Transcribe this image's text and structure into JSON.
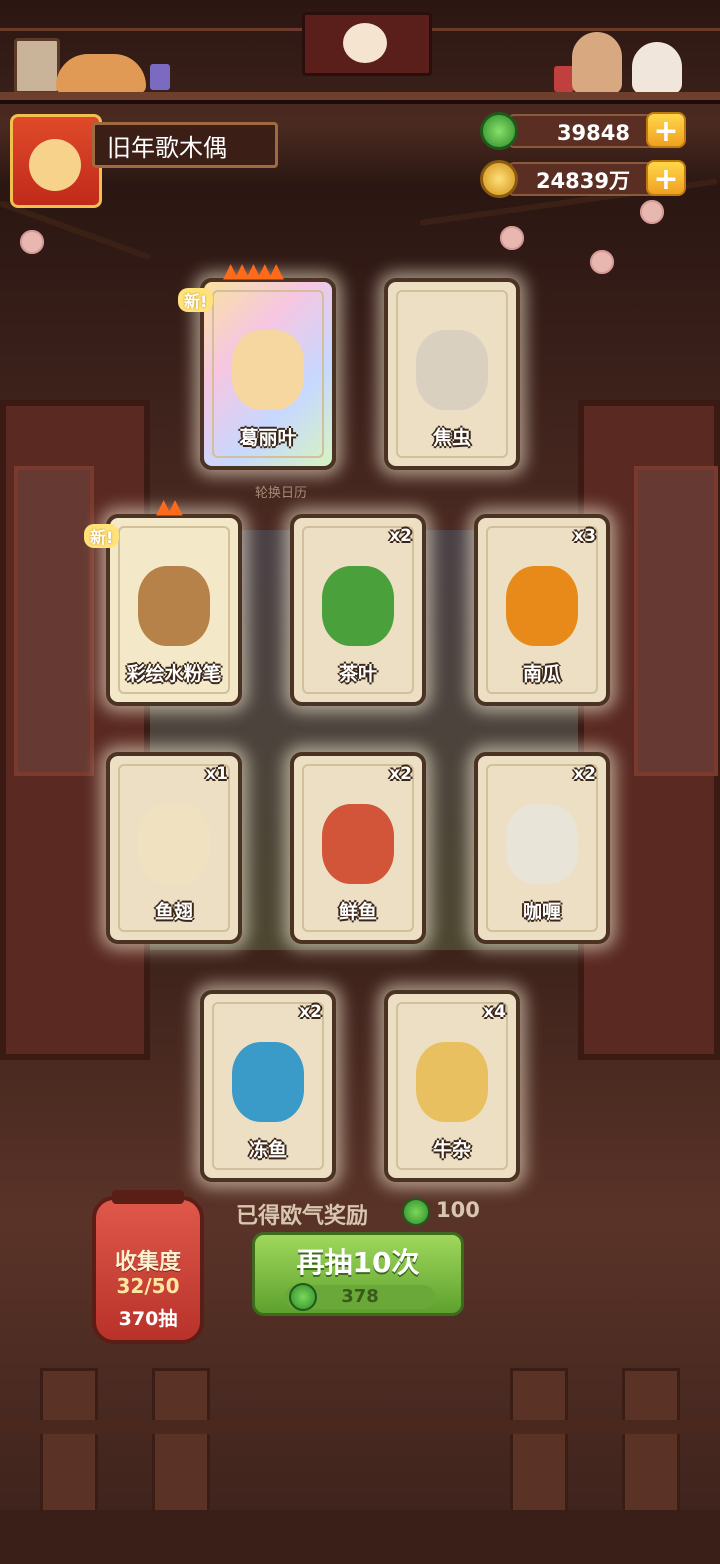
{
  "player": {
    "name": "旧年歌木偶"
  },
  "currency": {
    "jade": "39848",
    "coins": "24839万"
  },
  "icons": {
    "jade": "green-jade-icon",
    "coin": "gold-coin-icon",
    "plus": "plus-icon"
  },
  "panel_caption": "轮换日历",
  "new_tag": "新!",
  "cards": [
    {
      "name": "葛丽叶",
      "count": "",
      "is_new": true,
      "flames": 5,
      "style": "rainbow"
    },
    {
      "name": "焦虫",
      "count": "",
      "is_new": false,
      "flames": 0,
      "style": "plain"
    },
    {
      "name": "彩绘水粉笔",
      "count": "",
      "is_new": true,
      "flames": 2,
      "style": "glow"
    },
    {
      "name": "茶叶",
      "count": "x2",
      "is_new": false,
      "flames": 0,
      "style": "plain"
    },
    {
      "name": "南瓜",
      "count": "x3",
      "is_new": false,
      "flames": 0,
      "style": "plain"
    },
    {
      "name": "鱼翅",
      "count": "x1",
      "is_new": false,
      "flames": 0,
      "style": "plain"
    },
    {
      "name": "鲜鱼",
      "count": "x2",
      "is_new": false,
      "flames": 0,
      "style": "plain"
    },
    {
      "name": "咖喱",
      "count": "x2",
      "is_new": false,
      "flames": 0,
      "style": "plain"
    },
    {
      "name": "冻鱼",
      "count": "x2",
      "is_new": false,
      "flames": 0,
      "style": "plain"
    },
    {
      "name": "牛杂",
      "count": "x4",
      "is_new": false,
      "flames": 0,
      "style": "plain"
    }
  ],
  "reward": {
    "label": "已得欧气奖励",
    "value": "100"
  },
  "draw_button": {
    "label": "再抽10次",
    "cost": "378"
  },
  "collection": {
    "title": "收集度",
    "progress": "32/50",
    "draws": "370抽"
  },
  "colors": {
    "accent_green": "#6ab03a",
    "gold": "#f0b020",
    "card_bg": "#ecdfc4",
    "wood": "#4a2a20"
  }
}
